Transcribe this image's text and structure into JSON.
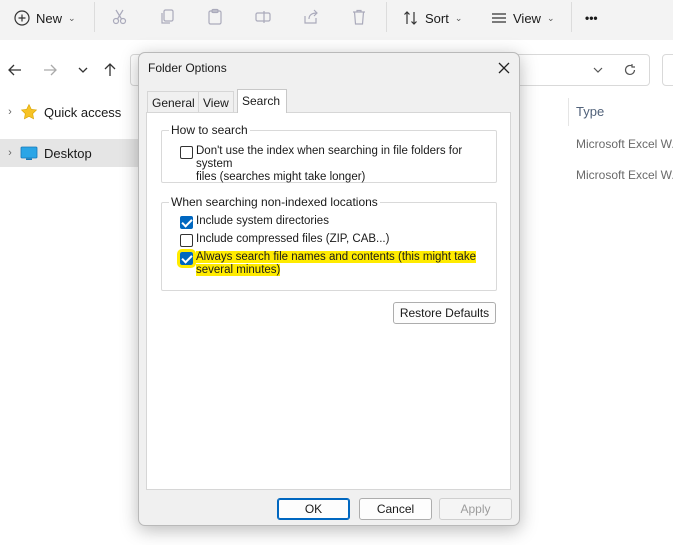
{
  "toolbar": {
    "new_label": "New",
    "sort_label": "Sort",
    "view_label": "View",
    "more_label": "•••"
  },
  "nav_pane": {
    "items": [
      {
        "label": "Quick access",
        "icon": "star-icon"
      },
      {
        "label": "Desktop",
        "icon": "desktop-icon",
        "selected": true
      }
    ]
  },
  "content": {
    "type_header": "Type",
    "rows": [
      "Microsoft Excel W...",
      "Microsoft Excel W..."
    ]
  },
  "dialog": {
    "title": "Folder Options",
    "tabs": [
      "General",
      "View",
      "Search"
    ],
    "active_tab": "Search",
    "how_to_search": {
      "label": "How to search",
      "option_line1": "Don't use the index when searching in file folders for system",
      "option_line2": "files (searches might take longer)",
      "checked": false
    },
    "non_indexed": {
      "label": "When searching non-indexed locations",
      "options": [
        {
          "text": "Include system directories",
          "checked": true
        },
        {
          "text": "Include compressed files (ZIP, CAB...)",
          "checked": false
        }
      ],
      "always_search_line1": "Always search file names and contents (this might take",
      "always_search_line2": "several minutes)",
      "always_search_checked": true,
      "highlight_color": "#ffeb00"
    },
    "restore_defaults_label": "Restore Defaults",
    "ok_label": "OK",
    "cancel_label": "Cancel",
    "apply_label": "Apply"
  },
  "colors": {
    "accent": "#0067c0",
    "toolbar_bg": "#f3f3f3",
    "selected_nav_bg": "#e5e5e5"
  }
}
